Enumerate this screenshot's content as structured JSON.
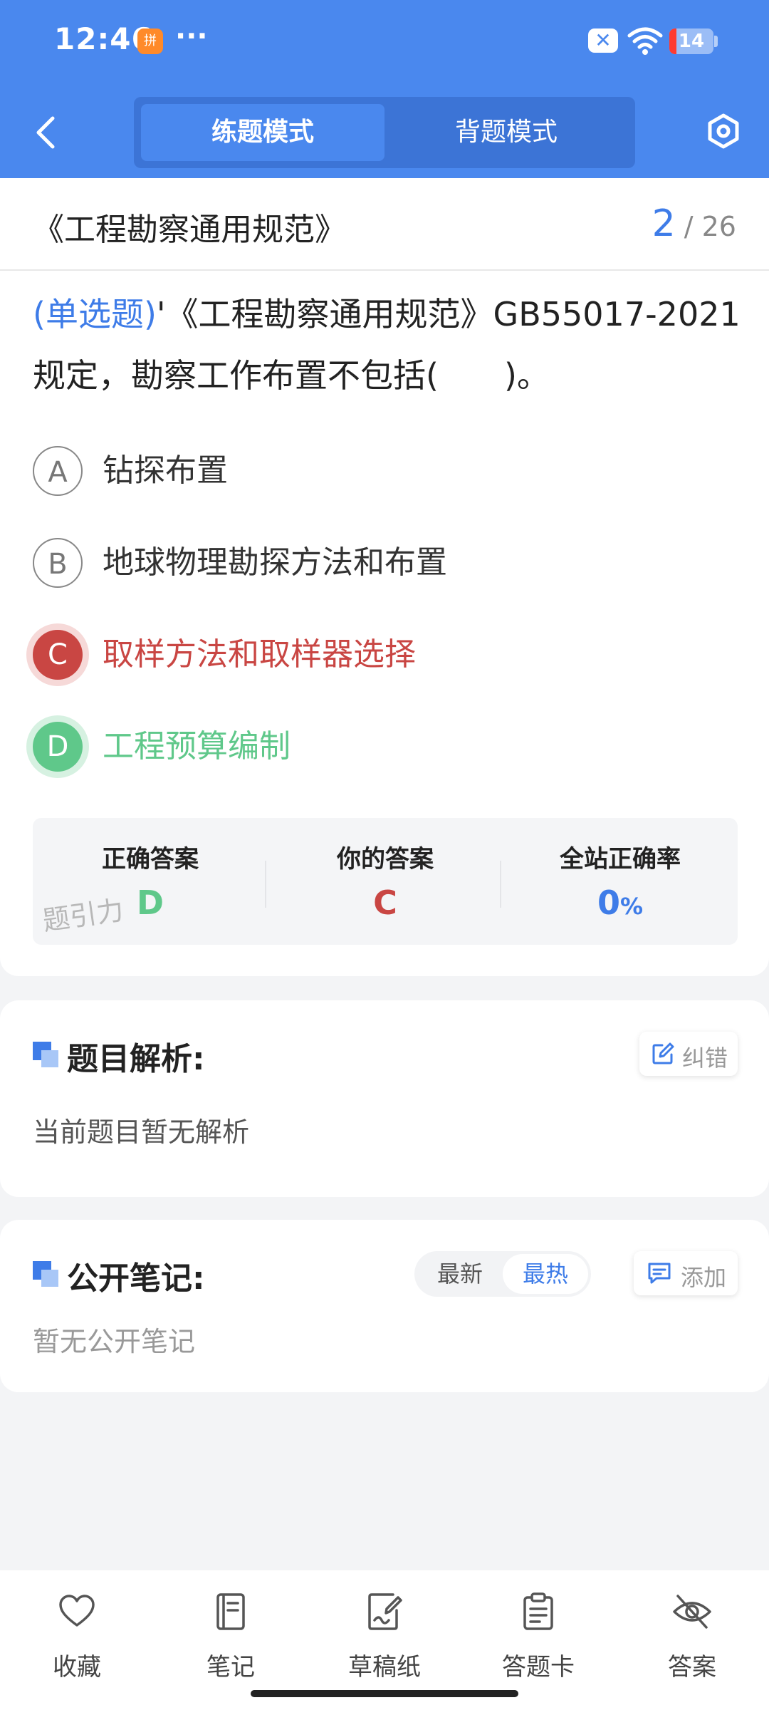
{
  "status_bar": {
    "time": "12:46",
    "app_badge": "拼",
    "more": "···",
    "battery": "14"
  },
  "header": {
    "mode_practice": "练题模式",
    "mode_review": "背题模式"
  },
  "question": {
    "doc_title": "《工程勘察通用规范》",
    "current": "2",
    "total": "/ 26",
    "type": "(单选题)",
    "text": "'《工程勘察通用规范》GB55017-2021规定，勘察工作布置不包括(　　)。",
    "options": [
      {
        "letter": "A",
        "text": "钻探布置"
      },
      {
        "letter": "B",
        "text": "地球物理勘探方法和布置"
      },
      {
        "letter": "C",
        "text": "取样方法和取样器选择"
      },
      {
        "letter": "D",
        "text": "工程预算编制"
      }
    ]
  },
  "answer": {
    "correct_label": "正确答案",
    "correct_value": "D",
    "yours_label": "你的答案",
    "yours_value": "C",
    "rate_label": "全站正确率",
    "rate_value": "0",
    "rate_unit": "%",
    "watermark": "题引力"
  },
  "analysis": {
    "title": "题目解析:",
    "report_label": "纠错",
    "content": "当前题目暂无解析"
  },
  "notes": {
    "title": "公开笔记:",
    "sort_latest": "最新",
    "sort_hot": "最热",
    "add_label": "添加",
    "empty": "暂无公开笔记"
  },
  "bottom_nav": {
    "items": [
      {
        "label": "收藏",
        "icon": "heart-icon"
      },
      {
        "label": "笔记",
        "icon": "notebook-icon"
      },
      {
        "label": "草稿纸",
        "icon": "draft-icon"
      },
      {
        "label": "答题卡",
        "icon": "clipboard-icon"
      },
      {
        "label": "答案",
        "icon": "eye-off-icon"
      }
    ]
  },
  "colors": {
    "primary": "#4a88ee",
    "wrong": "#c94643",
    "correct": "#5fc88a"
  }
}
